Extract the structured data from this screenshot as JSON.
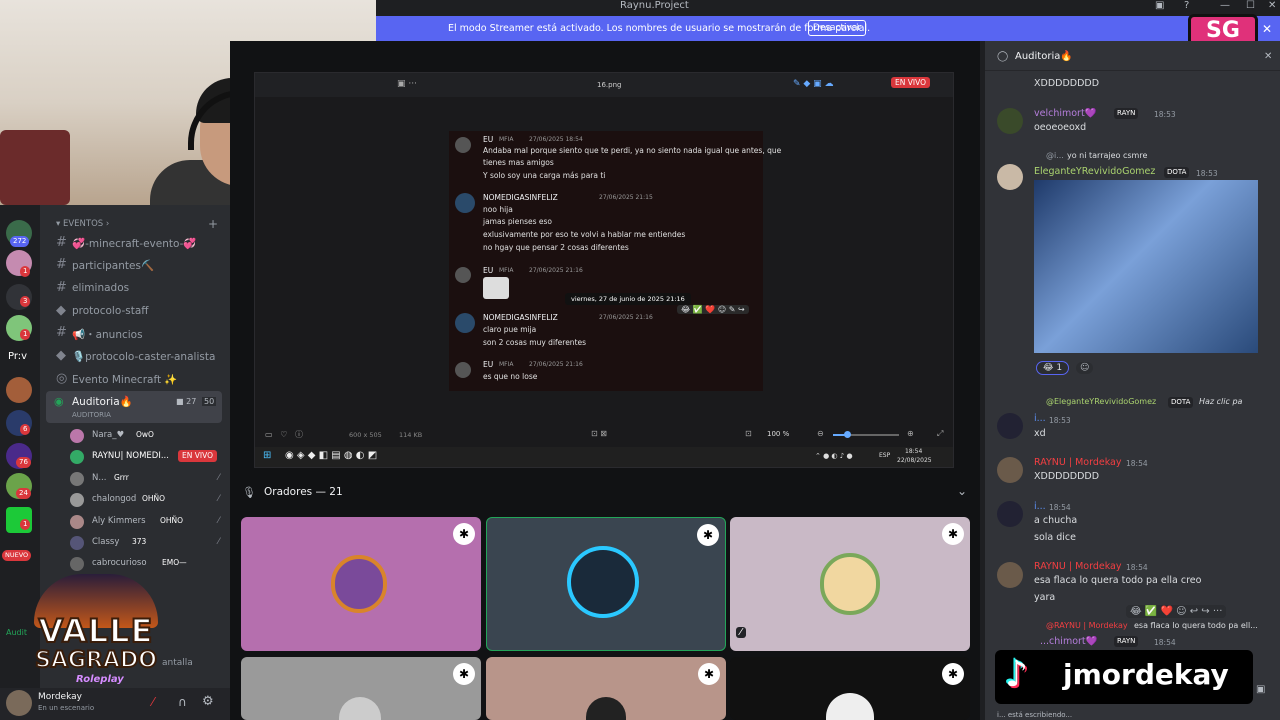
{
  "window": {
    "title": "Raynu.Project"
  },
  "banner": {
    "text": "El modo Streamer está activado. Los nombres de usuario se mostrarán de forma parcial.",
    "button": "Desactivar"
  },
  "server_badges": [
    "272",
    "1",
    "3",
    "1",
    "6",
    "76",
    "24",
    "1",
    "NUEVO"
  ],
  "server_letter": "Pr:v",
  "channels": {
    "category": "EVENTOS",
    "items": [
      "💞-minecraft-evento-💞",
      "participantes⛏️",
      "eliminados",
      "protocolo-staff",
      "📢・anuncios",
      "🎙️protocolo-caster-analista",
      "Evento Minecraft ✨"
    ],
    "voice": {
      "name": "Auditoria🔥",
      "sub": "AUDITORIA",
      "count_cam": "27",
      "count_users": "50"
    },
    "users": [
      {
        "name": "Nara_♥",
        "badge": "OwO"
      },
      {
        "name": "RAYNU| NOMEDI...",
        "badge": "EN VIVO"
      },
      {
        "name": "N...",
        "badge": "Grrr"
      },
      {
        "name": "chalongod",
        "badge": "OHÑO"
      },
      {
        "name": "Aly Kimmers",
        "badge": "OHÑO"
      },
      {
        "name": "Classy",
        "badge": "373"
      },
      {
        "name": "cabrocurioso",
        "badge": "EMO—"
      }
    ],
    "partial_1": "Audit",
    "partial_2": "antalla"
  },
  "user_panel": {
    "name": "Mordekay",
    "status": "En un escenario"
  },
  "overlay_logo": {
    "line1": "VALLE",
    "line2": "SAGRADO",
    "line3": "Roleplay"
  },
  "viewer": {
    "file": "16.png",
    "live": "EN VIVO",
    "meta_size": "600 x 505",
    "meta_bytes": "114 KB",
    "zoom": "100 %",
    "taskbar_lang": "ESP",
    "taskbar_time": "18:54",
    "taskbar_date": "22/08/2025",
    "shot": {
      "messages": [
        {
          "name": "EU",
          "tag": "MFIA",
          "time": "27/06/2025 18:54",
          "lines": [
            "Andaba mal porque siento que te perdi, ya no siento nada igual que antes, que",
            "tienes mas amigos",
            "Y solo soy una carga más para ti"
          ]
        },
        {
          "name": "NOMEDIGASINFELIZ",
          "tag": "",
          "time": "27/06/2025 21:15",
          "lines": [
            "noo hija",
            "jamas pienses eso",
            "exlusivamente por eso te volvi a hablar me entiendes",
            "no hgay que pensar 2 cosas diferentes"
          ]
        },
        {
          "name": "EU",
          "tag": "MFIA",
          "time": "27/06/2025 21:16",
          "lines": []
        },
        {
          "name": "NOMEDIGASINFELIZ",
          "tag": "",
          "time": "27/06/2025 21:16",
          "lines": [
            "claro pue mija",
            "son 2 cosas muy diferentes"
          ]
        },
        {
          "name": "EU",
          "tag": "MFIA",
          "time": "27/06/2025 21:16",
          "lines": [
            "es que no lose"
          ]
        }
      ],
      "tooltip": "viernes, 27 de junio de 2025 21:16"
    }
  },
  "stage": {
    "speakers": "Oradores — 21"
  },
  "chat": {
    "title": "Auditoria🔥",
    "messages": [
      {
        "text": "XDDDDDDDD"
      },
      {
        "name": "velchimort💜",
        "tag": "RAYN",
        "time": "18:53",
        "text": "oeoeoeoxd"
      },
      {
        "reply": "yo ni tarrajeo csmre",
        "reply_user": "@i...",
        "name": "EleganteYRevividoGomez",
        "tag": "DOTA",
        "time": "18:53",
        "reaction": "1"
      },
      {
        "reply": "Haz clic pa",
        "reply_user": "@EleganteYRevividoGomez",
        "reply_tag": "DOTA",
        "name": "i...",
        "time": "18:53",
        "text": "xd"
      },
      {
        "name": "RAYNU | Mordekay",
        "time": "18:54",
        "text": "XDDDDDDDD"
      },
      {
        "name": "i...",
        "time": "18:54",
        "text": "a chucha",
        "text2": "sola dice"
      },
      {
        "name": "RAYNU | Mordekay",
        "time": "18:54",
        "text": "esa flaca lo quera todo pa ella creo",
        "text2": "yara"
      },
      {
        "reply_user": "@RAYNU | Mordekay",
        "reply": "esa flaca lo quera todo pa ell...",
        "name": "...chimort💜",
        "tag": "RAYN",
        "time": "18:54"
      }
    ],
    "typing": "i... está escribiendo...",
    "tiktok": "jmordekay"
  },
  "colors": {
    "blurple": "#5865f2",
    "live_red": "#da373c",
    "stage_bg": "#111214",
    "name_red": "#f23f42",
    "name_green": "#aad36f",
    "name_purple": "#b57edc"
  }
}
